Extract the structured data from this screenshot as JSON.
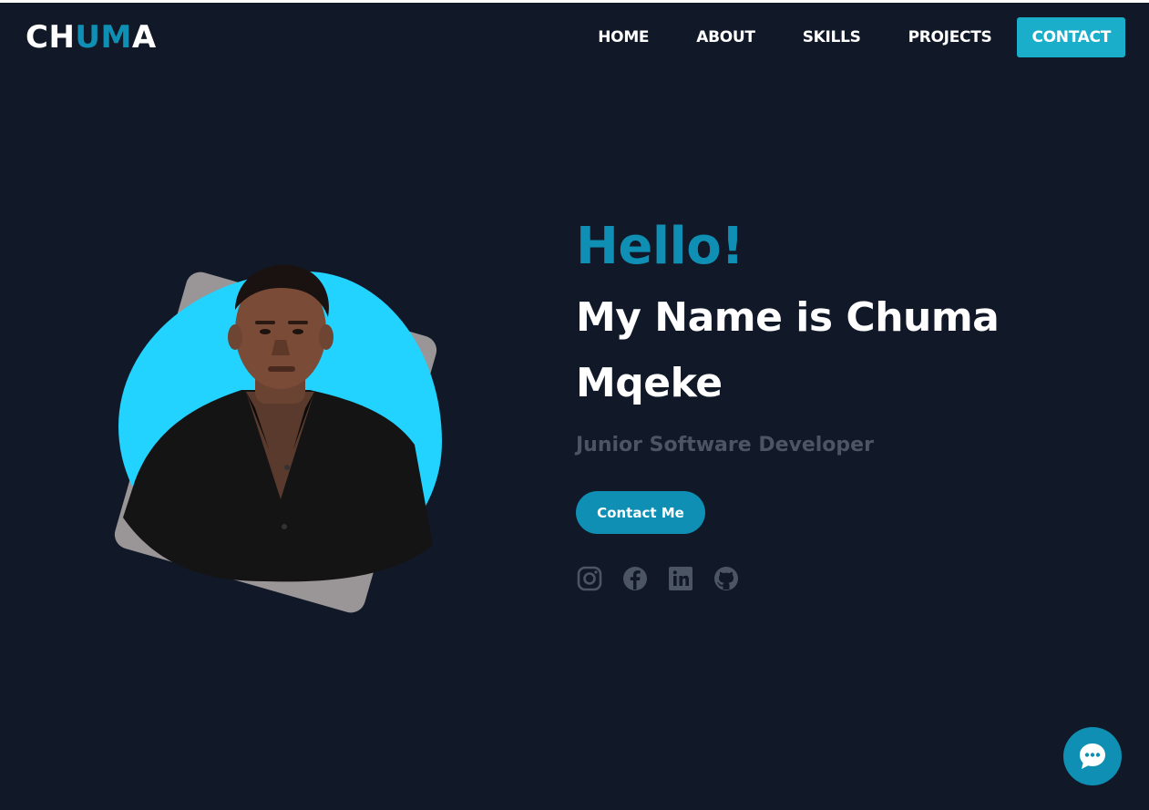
{
  "brand": {
    "logo_part1": "CH",
    "logo_part2": "UM",
    "logo_part3": "A"
  },
  "nav": {
    "items": [
      {
        "label": "HOME"
      },
      {
        "label": "ABOUT"
      },
      {
        "label": "SKILLS"
      },
      {
        "label": "PROJECTS"
      },
      {
        "label": "CONTACT"
      }
    ]
  },
  "hero": {
    "greeting": "Hello!",
    "name": "My Name is Chuma Mqeke",
    "role": "Junior Software Developer",
    "cta_label": "Contact Me",
    "socials": [
      {
        "icon": "instagram-icon"
      },
      {
        "icon": "facebook-icon"
      },
      {
        "icon": "linkedin-icon"
      },
      {
        "icon": "github-icon"
      }
    ]
  },
  "chat": {
    "icon": "chat-bubble-icon"
  },
  "colors": {
    "background": "#111827",
    "accent": "#0e8fb3",
    "nav_contact_bg": "#1aaecb",
    "blob": "#22d3ff",
    "muted_text": "#4b5563"
  }
}
